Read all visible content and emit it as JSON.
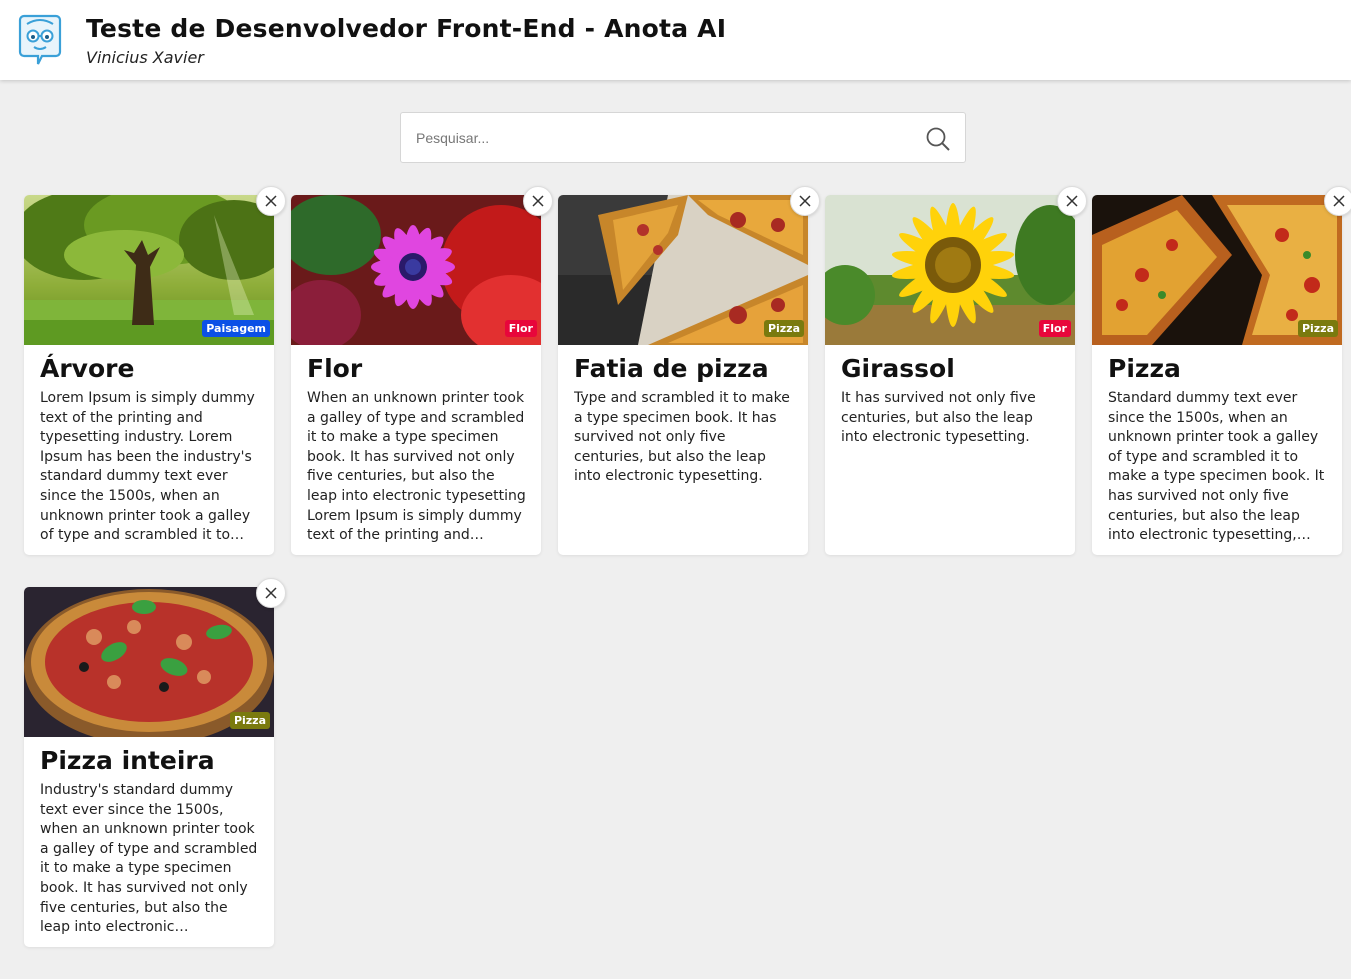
{
  "header": {
    "title": "Teste de Desenvolvedor Front-End - Anota AI",
    "author": "Vinicius Xavier",
    "logo_icon": "nerd-face-logo-icon"
  },
  "search": {
    "placeholder": "Pesquisar...",
    "value": "",
    "icon": "search-icon"
  },
  "colors": {
    "paisagem": "#0b50e6",
    "flor": "#e8063b",
    "pizza": "#7a7a0e"
  },
  "cards": [
    {
      "title": "Árvore",
      "tag": "Paisagem",
      "description": "Lorem Ipsum is simply dummy text of the printing and typesetting industry. Lorem Ipsum has been the industry's standard dummy text ever since the 1500s, when an unknown printer took a galley of type and scrambled it to make a type specimen book."
    },
    {
      "title": "Flor",
      "tag": "Flor",
      "description": "When an unknown printer took a galley of type and scrambled it to make a type specimen book. It has survived not only five centuries, but also the leap into electronic typesetting Lorem Ipsum is simply dummy text of the printing and typesetting industry."
    },
    {
      "title": "Fatia de pizza",
      "tag": "Pizza",
      "description": "Type and scrambled it to make a type specimen book. It has survived not only five centuries, but also the leap into electronic typesetting."
    },
    {
      "title": "Girassol",
      "tag": "Flor",
      "description": "It has survived not only five centuries, but also the leap into electronic typesetting."
    },
    {
      "title": "Pizza",
      "tag": "Pizza",
      "description": "Standard dummy text ever since the 1500s, when an unknown printer took a galley of type and scrambled it to make a type specimen book. It has survived not only five centuries, but also the leap into electronic typesetting, remaining essentially unchanged."
    },
    {
      "title": "Pizza inteira",
      "tag": "Pizza",
      "description": "Industry's standard dummy text ever since the 1500s, when an unknown printer took a galley of type and scrambled it to make a type specimen book. It has survived not only five centuries, but also the leap into electronic typesetting, remaining essentially unchanged."
    }
  ]
}
